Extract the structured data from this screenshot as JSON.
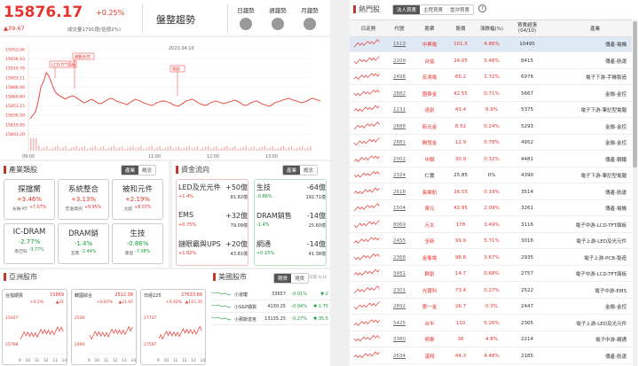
{
  "index": {
    "value": "15876.17",
    "pct": "+0.25%",
    "change": "▲39.67",
    "volume": "成交量1791億(估億2%)",
    "trend_label": "盤整趨勢",
    "trend_tabs": [
      "日趨勢",
      "週趨勢",
      "月趨勢"
    ]
  },
  "main_chart": {
    "date": "2023.04.10",
    "y_ticks": [
      "15953.06",
      "15936.43",
      "15919.76",
      "15903.11",
      "15886.46",
      "15869.80",
      "15853.15",
      "15836.50",
      "15819.85",
      "15803.20"
    ],
    "x_ticks": [
      "09:00",
      "11:00",
      "12:00",
      "13:00"
    ],
    "annotations": [
      "LCD-TFT面板",
      "被動元件",
      "塑膠"
    ]
  },
  "industry": {
    "title": "產業類股",
    "tabs": [
      "產業",
      "概念"
    ],
    "cards": [
      {
        "name": "探擋嚮",
        "pct": "+3.46%",
        "sub1": "永振-KY",
        "sub2": "+7.07%",
        "dir": "up"
      },
      {
        "name": "系統整合",
        "pct": "+3.13%",
        "sub1": "宏碁資訊",
        "sub2": "+9.95%",
        "dir": "up"
      },
      {
        "name": "被和元件",
        "pct": "+2.19%",
        "sub1": "允超",
        "sub2": "+8.07%",
        "dir": "up"
      },
      {
        "name": "IC-DRAM",
        "pct": "-2.77%",
        "sub1": "南亞科",
        "sub2": "-3.77%",
        "dir": "dn"
      },
      {
        "name": "DRAM銷",
        "pct": "-1.4%",
        "sub1": "宜鼎",
        "sub2": "-2.44%",
        "dir": "dn"
      },
      {
        "name": "生技",
        "pct": "-0.86%",
        "sub1": "康呈",
        "sub2": "-7.08%",
        "dir": "dn"
      }
    ]
  },
  "flow": {
    "title": "資金流向",
    "tabs": [
      "產業",
      "概念"
    ],
    "up": [
      {
        "name": "LED及光元件",
        "val": "+50億",
        "pct": "+1.4%",
        "amt": "81.82億"
      },
      {
        "name": "EMS",
        "val": "+32億",
        "pct": "+0.75%",
        "amt": "79.09億"
      },
      {
        "name": "鏈眼霸與UPS",
        "val": "+20億",
        "pct": "+1.82%",
        "amt": "43.81億"
      }
    ],
    "down": [
      {
        "name": "生技",
        "val": "-64億",
        "pct": "-0.86%",
        "amt": "192.71億"
      },
      {
        "name": "DRAM銷售",
        "val": "-14億",
        "pct": "-1.4%",
        "amt": "25.60億"
      },
      {
        "name": "網通",
        "val": "-14億",
        "pct": "+0.15%",
        "amt": "41.38億"
      }
    ]
  },
  "asia": {
    "title": "亞洲股市",
    "markets": [
      {
        "name": "台指期貨",
        "value": "15869",
        "chg": "+0.2%",
        "pts": "▲31",
        "y1": "15927",
        "y2": "15798"
      },
      {
        "name": "韓國綜合",
        "value": "2512.08",
        "chg": "+0.87%",
        "pts": "▲21.67",
        "y1": "2520",
        "y2": "2490"
      },
      {
        "name": "日經225",
        "value": "27633.66",
        "chg": "+0.42%",
        "pts": "▲115.35",
        "y1": "27737",
        "y2": "27597"
      }
    ],
    "x_ticks": [
      "9",
      "10",
      "11",
      "12",
      "13",
      "14"
    ]
  },
  "us": {
    "title": "美國股市",
    "tabs": [
      "期貨",
      "現貨"
    ],
    "note": "日期 4/10",
    "rows": [
      {
        "name": "小道瓊",
        "value": "33657",
        "pct": "-0.01%",
        "pts": "▼-2"
      },
      {
        "name": "小S&P期貨",
        "value": "4130.25",
        "pct": "-0.04%",
        "pts": "▼-1.75"
      },
      {
        "name": "小那斯達克",
        "value": "13135.25",
        "pct": "-0.27%",
        "pts": "▼-35.5"
      }
    ]
  },
  "hot": {
    "title": "熱門股",
    "tabs": [
      "法人買賣",
      "主程買賣",
      "當沖買賣"
    ],
    "help": "?",
    "headers": [
      "日走勢",
      "代號",
      "股票",
      "股價",
      "漲跌幅(%)",
      "買賣超張",
      "(04/10)",
      "產業"
    ],
    "rows": [
      {
        "code": "1513",
        "name": "中興電",
        "price": "101.5",
        "pct": "4.86%",
        "vol": "10495",
        "ind": "傳產-電機",
        "dir": "up"
      },
      {
        "code": "2209",
        "name": "台益",
        "price": "24.05",
        "pct": "5.48%",
        "vol": "8415",
        "ind": "傳產-航運",
        "dir": "up"
      },
      {
        "code": "2498",
        "name": "宏達電",
        "price": "65.2",
        "pct": "1.72%",
        "vol": "6976",
        "ind": "電子下游-手機製造",
        "dir": "up"
      },
      {
        "code": "2882",
        "name": "國泰金",
        "price": "42.55",
        "pct": "0.71%",
        "vol": "5667",
        "ind": "金融-金控",
        "dir": "up"
      },
      {
        "code": "1231",
        "name": "遠創",
        "price": "43.4",
        "pct": "6.9%",
        "vol": "5375",
        "ind": "電子下游-筆記型電腦",
        "dir": "up"
      },
      {
        "code": "2888",
        "name": "新光金",
        "price": "8.52",
        "pct": "0.24%",
        "vol": "5293",
        "ind": "金融-金控",
        "dir": "up"
      },
      {
        "code": "2881",
        "name": "開發金",
        "price": "12.9",
        "pct": "0.78%",
        "vol": "4952",
        "ind": "金融-金控",
        "dir": "up"
      },
      {
        "code": "2002",
        "name": "中鋼",
        "price": "30.9",
        "pct": "0.32%",
        "vol": "4481",
        "ind": "傳產-鋼鐵",
        "dir": "up"
      },
      {
        "code": "2324",
        "name": "仁寶",
        "price": "25.85",
        "pct": "0%",
        "vol": "4390",
        "ind": "電子下游-筆記型電腦",
        "dir": "flat"
      },
      {
        "code": "2618",
        "name": "長榮航",
        "price": "26.55",
        "pct": "0.19%",
        "vol": "3514",
        "ind": "傳產-航運",
        "dir": "up"
      },
      {
        "code": "1504",
        "name": "東元",
        "price": "43.95",
        "pct": "2.09%",
        "vol": "3261",
        "ind": "傳產-電機",
        "dir": "up"
      },
      {
        "code": "8069",
        "name": "元太",
        "price": "178",
        "pct": "3.49%",
        "vol": "3116",
        "ind": "電子中游-LCD-TFT面板",
        "dir": "up"
      },
      {
        "code": "2455",
        "name": "全新",
        "price": "99.9",
        "pct": "5.71%",
        "vol": "3016",
        "ind": "電子上游-LED及光元件",
        "dir": "up"
      },
      {
        "code": "2368",
        "name": "金像電",
        "price": "98.8",
        "pct": "3.67%",
        "vol": "2935",
        "ind": "電子上游-PCB-製造",
        "dir": "up"
      },
      {
        "code": "3481",
        "name": "群創",
        "price": "14.7",
        "pct": "0.68%",
        "vol": "2757",
        "ind": "電子中游-LCD-TFT面板",
        "dir": "up"
      },
      {
        "code": "2301",
        "name": "光寶科",
        "price": "73.4",
        "pct": "0.27%",
        "vol": "2522",
        "ind": "電子中游-EMS",
        "dir": "up"
      },
      {
        "code": "2892",
        "name": "第一金",
        "price": "26.7",
        "pct": "0.3%",
        "vol": "2447",
        "ind": "金融-金控",
        "dir": "up"
      },
      {
        "code": "5425",
        "name": "台半",
        "price": "110",
        "pct": "5.26%",
        "vol": "2305",
        "ind": "電子上游-LED及光元件",
        "dir": "up"
      },
      {
        "code": "3380",
        "name": "明泰",
        "price": "36",
        "pct": "4.8%",
        "vol": "2214",
        "ind": "電子中游-網通",
        "dir": "up"
      },
      {
        "code": "2634",
        "name": "漢翔",
        "price": "44.3",
        "pct": "4.48%",
        "vol": "2185",
        "ind": "傳產-航運",
        "dir": "up"
      }
    ]
  },
  "colors": {
    "up": "#e8342e",
    "down": "#1a9c3b",
    "accent": "#c0392b"
  }
}
